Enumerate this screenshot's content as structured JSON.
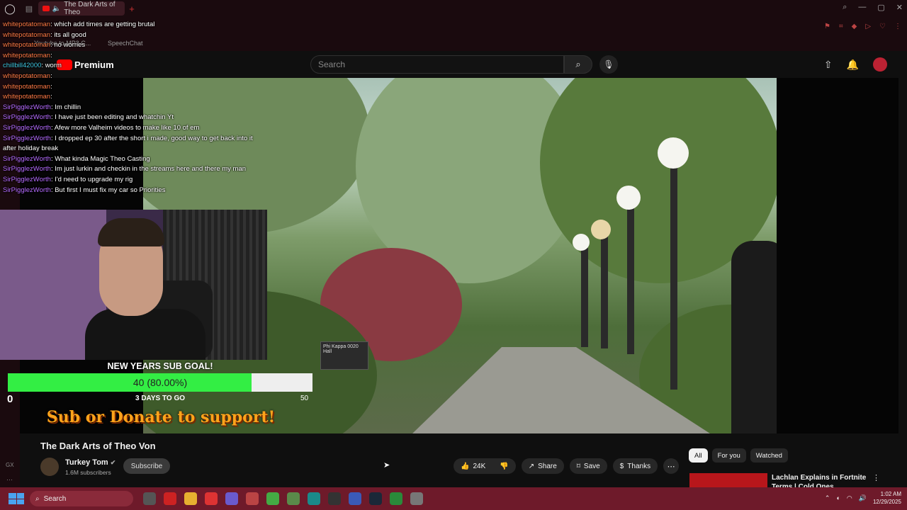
{
  "browser": {
    "tab_title": "The Dark Arts of Theo",
    "bookmarks": [
      "Youtube to MP3 C...",
      "SpeechChat"
    ]
  },
  "youtube_header": {
    "logo_text": "Premium",
    "search_placeholder": "Search"
  },
  "chat": [
    {
      "user": "whitepotatoman",
      "msg": "which add times are getting brutal",
      "color": "wp"
    },
    {
      "user": "whitepotatoman",
      "msg": "its all good",
      "color": "wp"
    },
    {
      "user": "whitepotatoman",
      "msg": "no worries",
      "color": "wp"
    },
    {
      "user": "whitepotatoman",
      "msg": "",
      "color": "wp"
    },
    {
      "user": "chillbill42000",
      "msg": "worm",
      "color": "cb"
    },
    {
      "user": "whitepotatoman",
      "msg": "",
      "color": "wp"
    },
    {
      "user": "whitepotatoman",
      "msg": "",
      "color": "wp"
    },
    {
      "user": "whitepotatoman",
      "msg": "",
      "color": "wp"
    },
    {
      "user": "SirPigglezWorth",
      "msg": "Im chillin",
      "color": "sp"
    },
    {
      "user": "SirPigglezWorth",
      "msg": "I have just been editing and whatchin Yt",
      "color": "sp"
    },
    {
      "user": "SirPigglezWorth",
      "msg": "Afew more Valheim videos to make like 10 of em",
      "color": "sp"
    },
    {
      "user": "SirPigglezWorth",
      "msg": "I dropped ep 30 after the short i made, good way to get back into it after holiday break",
      "color": "sp"
    },
    {
      "user": "SirPigglezWorth",
      "msg": "What kinda Magic Theo Casting",
      "color": "sp"
    },
    {
      "user": "SirPigglezWorth",
      "msg": "Im just lurkin and checkin in the streams here and there my man",
      "color": "sp"
    },
    {
      "user": "SirPigglezWorth",
      "msg": "I'd need to upgrade my rig",
      "color": "sp"
    },
    {
      "user": "SirPigglezWorth",
      "msg": "But first I must fix my car so Priorities",
      "color": "sp"
    }
  ],
  "sub_goal": {
    "title": "NEW YEARS SUB GOAL!",
    "progress_text": "40 (80.00%)",
    "progress_fraction": 0.8,
    "min": "0",
    "max": "50",
    "days_left": "3 DAYS TO GO",
    "support_text": "Sub or Donate to support!"
  },
  "scene": {
    "sign_text": "Phi Kappa 0020 Hall"
  },
  "video": {
    "title": "The Dark Arts of Theo Von",
    "channel": "Turkey Tom",
    "subscribers": "1.6M subscribers",
    "subscribe_label": "Subscribe",
    "likes": "24K",
    "share_label": "Share",
    "save_label": "Save",
    "thanks_label": "Thanks"
  },
  "recommendations": {
    "chips": [
      "All",
      "For you",
      "Watched"
    ],
    "first_title": "Lachlan Explains in Fortnite Terms | Cold Ones"
  },
  "taskbar": {
    "search_label": "Search",
    "time": "1:02 AM",
    "date": "12/29/2025"
  },
  "colors": {
    "taskbar": "#6e1a2a",
    "goal_fill": "#33ee44",
    "support_text": "#ffa41b"
  }
}
